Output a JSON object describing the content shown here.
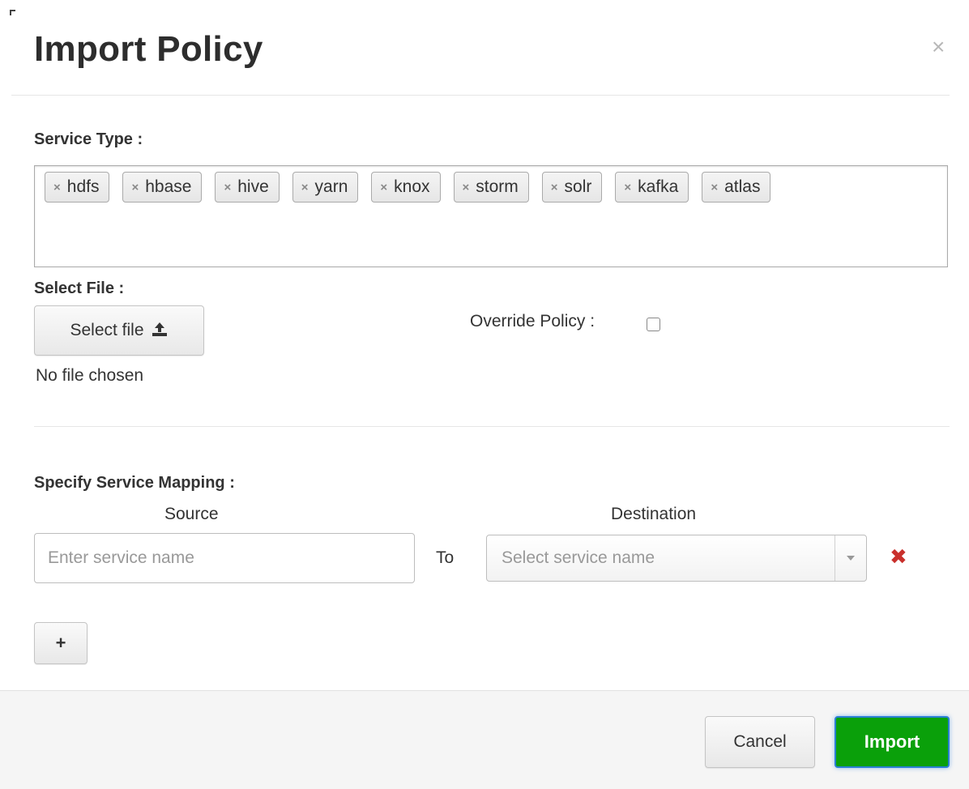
{
  "dialog": {
    "title": "Import Policy",
    "close_symbol": "×"
  },
  "service_type": {
    "label": "Service Type :",
    "remove_symbol": "×",
    "tags": [
      "hdfs",
      "hbase",
      "hive",
      "yarn",
      "knox",
      "storm",
      "solr",
      "kafka",
      "atlas"
    ]
  },
  "select_file": {
    "label": "Select File :",
    "button_label": "Select file",
    "upload_icon": "upload-icon",
    "status": "No file chosen"
  },
  "override_policy": {
    "label": "Override Policy :",
    "checked": false
  },
  "mapping": {
    "label": "Specify Service Mapping :",
    "source_header": "Source",
    "destination_header": "Destination",
    "source_placeholder": "Enter service name",
    "source_value": "",
    "to_label": "To",
    "destination_placeholder": "Select service name",
    "remove_icon": "remove-icon",
    "remove_symbol": "✖",
    "add_button_label": "+"
  },
  "footer": {
    "cancel_label": "Cancel",
    "import_label": "Import"
  },
  "colors": {
    "import_button": "#0aa00a",
    "remove_icon": "#c9302c",
    "footer_background": "#f5f5f5"
  }
}
